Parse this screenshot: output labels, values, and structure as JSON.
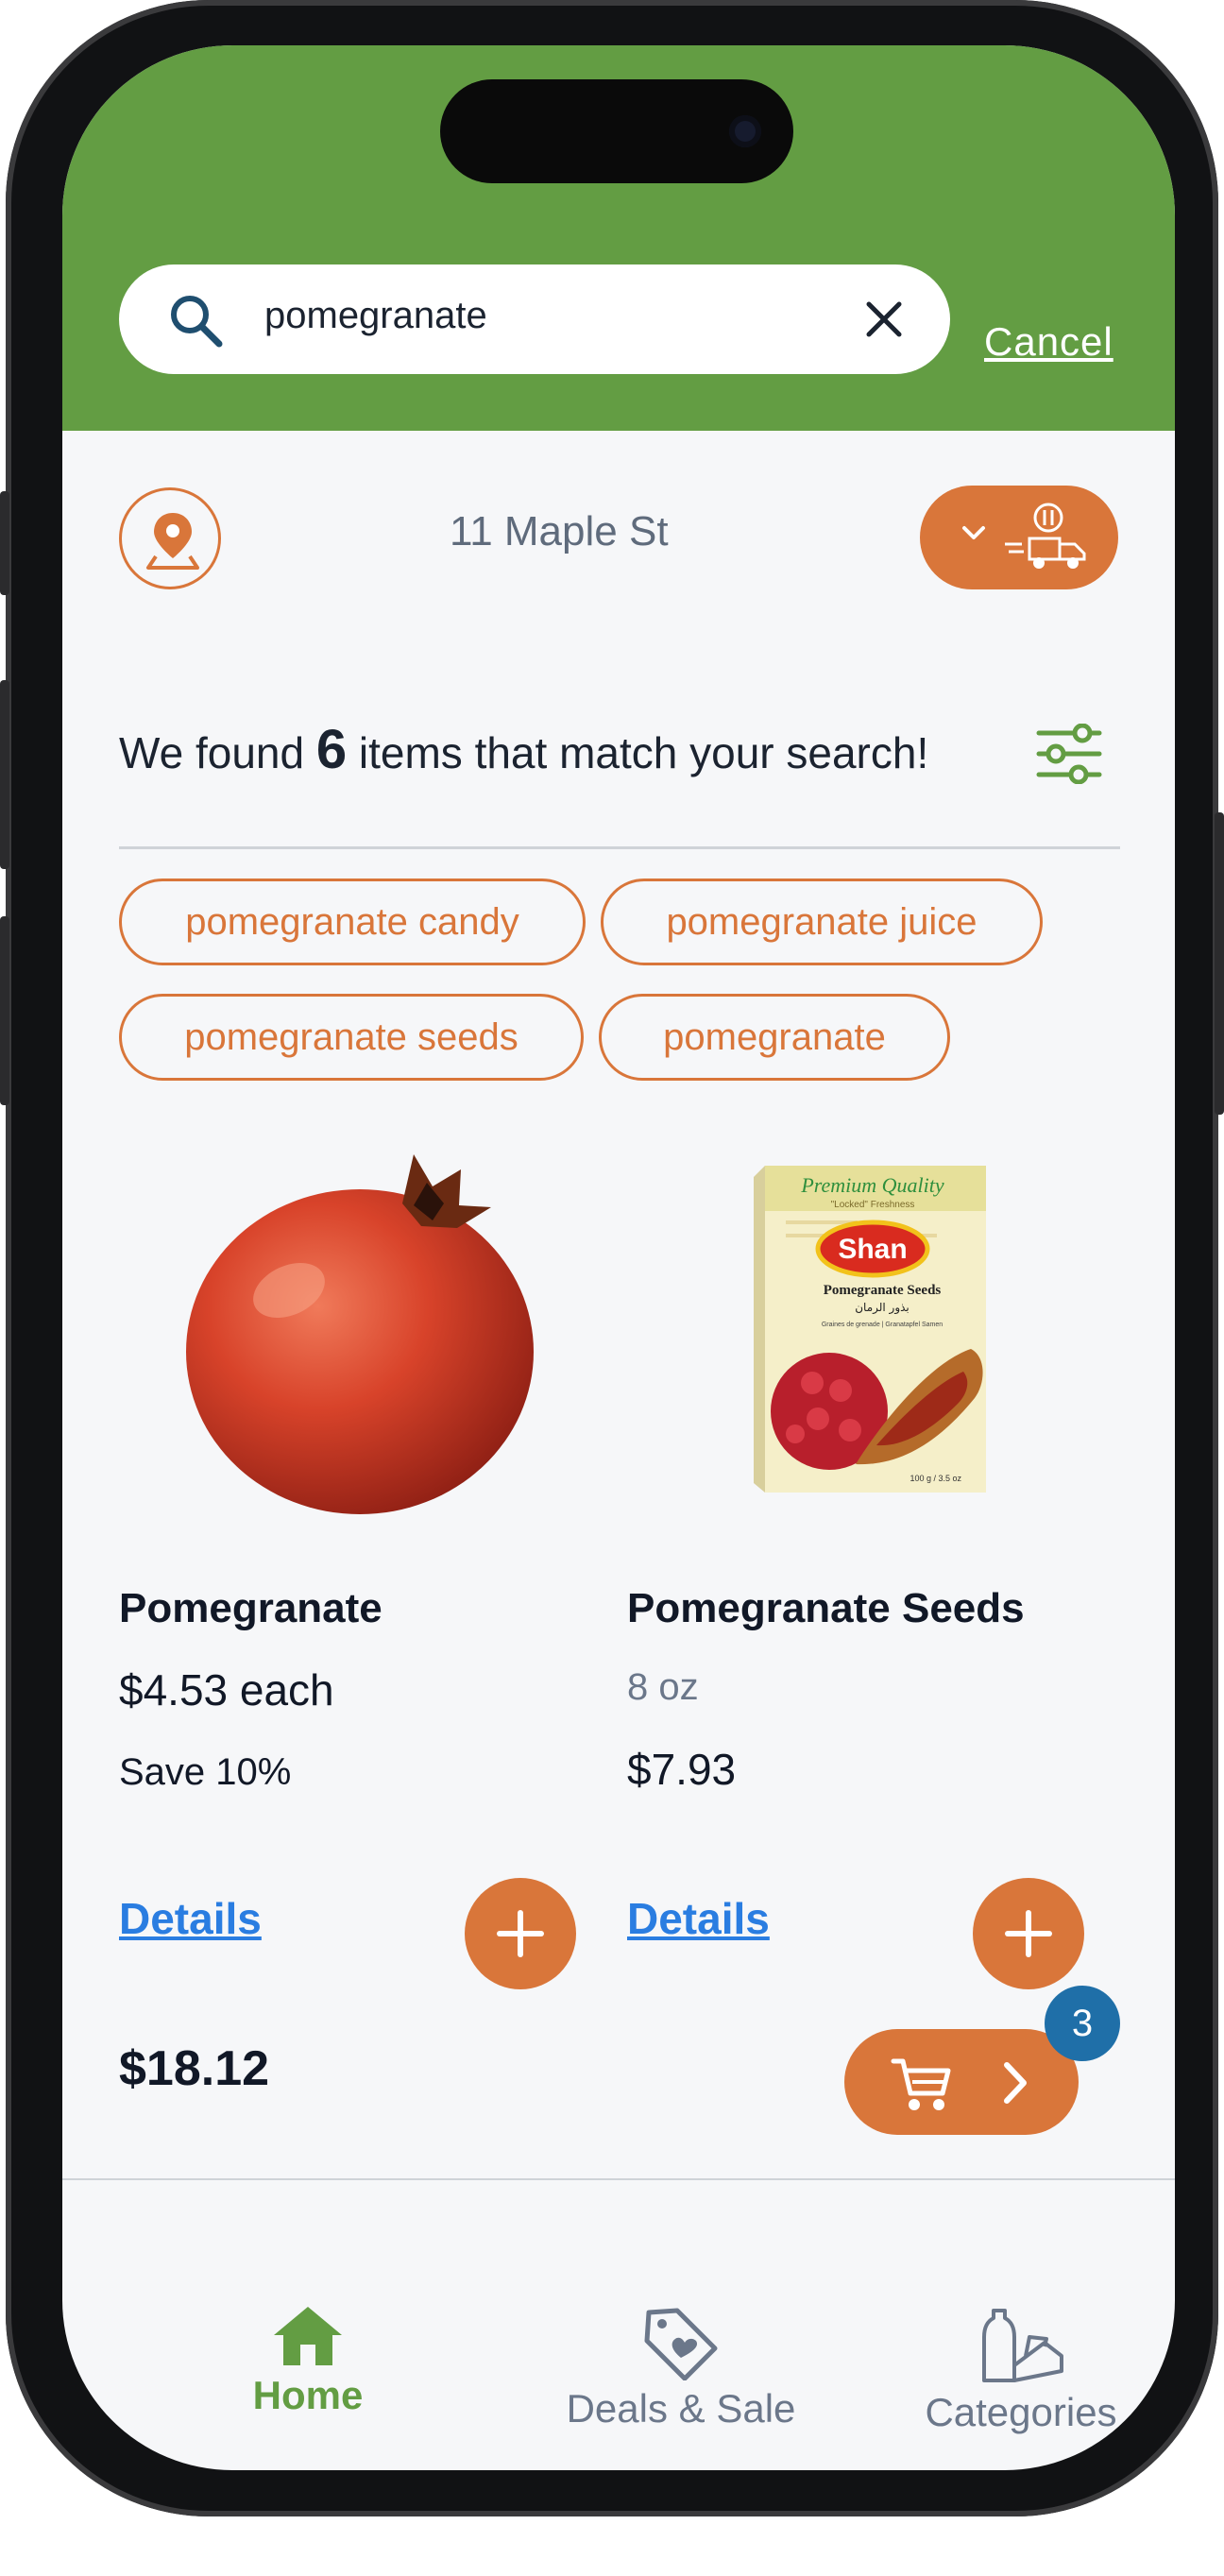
{
  "search": {
    "query": "pomegranate",
    "cancel_label": "Cancel"
  },
  "location": {
    "address": "11 Maple St"
  },
  "results": {
    "prefix": "We found ",
    "count": "6",
    "suffix": " items that match your search!"
  },
  "suggestions": [
    "pomegranate candy",
    "pomegranate juice",
    "pomegranate seeds",
    "pomegranate"
  ],
  "products": [
    {
      "name": "Pomegranate",
      "price": "$4.53 each",
      "promo": "Save 10%",
      "details_label": "Details"
    },
    {
      "name": "Pomegranate Seeds",
      "size": "8 oz",
      "price": "$7.93",
      "details_label": "Details"
    }
  ],
  "package_art": {
    "top_banner": "Premium Quality",
    "tagline": "\"Locked\" Freshness",
    "brand": "Shan",
    "product": "Pomegranate Seeds",
    "arabic": "بذور الرمان",
    "subtitle": "Graines de grenade  |  Granatapfel Samen",
    "weight": "100 g / 3.5 oz"
  },
  "cart": {
    "total": "$18.12",
    "item_count": "3"
  },
  "nav": {
    "home": "Home",
    "deals": "Deals & Sale",
    "categories": "Categories"
  },
  "colors": {
    "brand_green": "#639d43",
    "accent_orange": "#d9763a",
    "link_blue": "#2a7de1",
    "badge_blue": "#1f6fa8"
  },
  "icons": [
    "search-icon",
    "clear-icon",
    "location-pin-icon",
    "chevron-down-icon",
    "delivery-truck-icon",
    "filter-sliders-icon",
    "plus-icon",
    "cart-icon",
    "chevron-right-icon",
    "home-icon",
    "tag-heart-icon",
    "categories-icon"
  ]
}
